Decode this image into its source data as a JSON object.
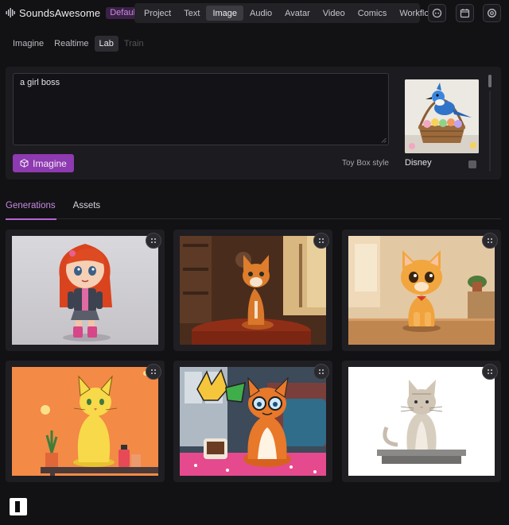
{
  "app": {
    "name": "SoundsAwesome",
    "badge": "Default"
  },
  "main_nav": {
    "items": [
      {
        "label": "Project",
        "active": false
      },
      {
        "label": "Text",
        "active": false
      },
      {
        "label": "Image",
        "active": true
      },
      {
        "label": "Audio",
        "active": false
      },
      {
        "label": "Avatar",
        "active": false
      },
      {
        "label": "Video",
        "active": false
      },
      {
        "label": "Comics",
        "active": false
      },
      {
        "label": "Workflow",
        "active": false
      }
    ]
  },
  "header_icons": [
    "discord-icon",
    "calendar-icon",
    "settings-icon"
  ],
  "mode_tabs": [
    {
      "label": "Imagine",
      "state": "normal"
    },
    {
      "label": "Realtime",
      "state": "normal"
    },
    {
      "label": "Lab",
      "state": "active"
    },
    {
      "label": "Train",
      "state": "disabled"
    }
  ],
  "prompt": {
    "value": "a girl boss",
    "button_label": "Imagine",
    "style_label": "Toy Box style",
    "style_name": "Disney"
  },
  "result_tabs": [
    {
      "label": "Generations",
      "active": true
    },
    {
      "label": "Assets",
      "active": false
    }
  ],
  "gallery": [
    {
      "subject": "red-haired-toy-girl"
    },
    {
      "subject": "orange-cat-on-table"
    },
    {
      "subject": "orange-kitten-on-table"
    },
    {
      "subject": "yellow-cat-on-orange"
    },
    {
      "subject": "comic-cat-with-glasses"
    },
    {
      "subject": "grey-kitten-on-platform"
    }
  ],
  "colors": {
    "accent": "#8e3ab0",
    "accent_text": "#c58be0",
    "background": "#121114",
    "panel": "#1c1b1f"
  }
}
